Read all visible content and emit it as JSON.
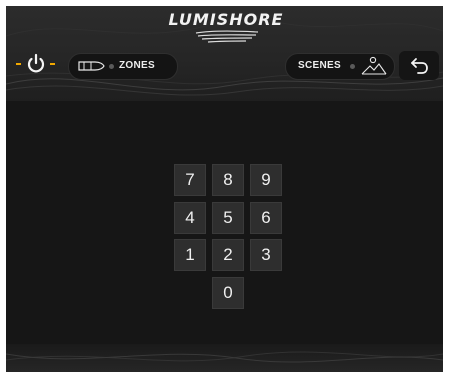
{
  "header": {
    "logo_text": "LUMISHORE",
    "zones_label": "ZONES",
    "scenes_label": "SCENES",
    "accent_color": "#f2a800"
  },
  "icons": {
    "power": "power-icon",
    "zones": "boat-icon",
    "scenes": "mountain-scene-icon",
    "back": "back-arrow-icon"
  },
  "keypad": {
    "keys": [
      "7",
      "8",
      "9",
      "4",
      "5",
      "6",
      "1",
      "2",
      "3",
      "0"
    ]
  }
}
